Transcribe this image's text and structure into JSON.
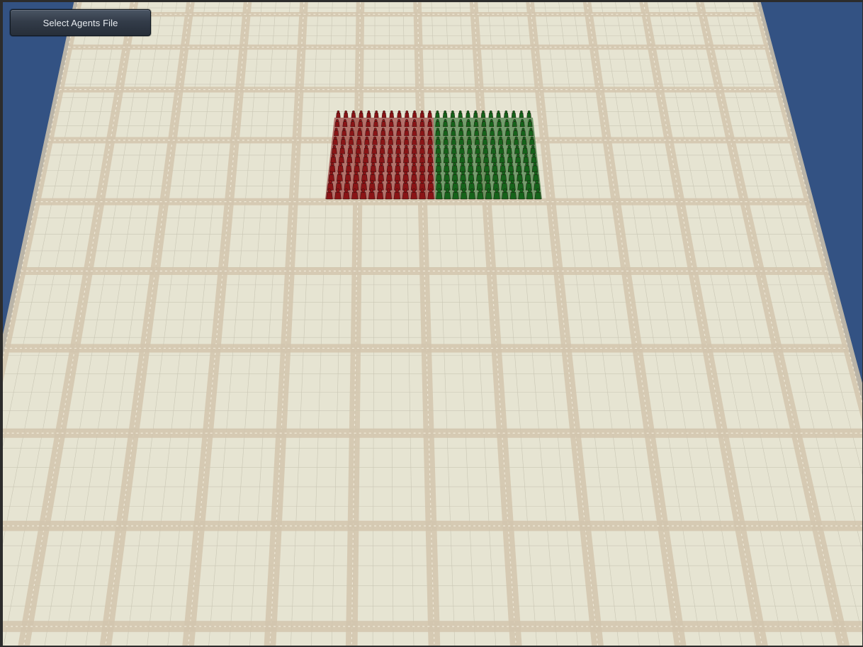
{
  "ui": {
    "select_agents_file_label": "Select Agents File"
  },
  "scene": {
    "sky_color": "#335283",
    "floor_base_color": "#e6e4d2",
    "floor_band_color": "#d2c6ae",
    "floor_grid_line_color": "#c9c6b4",
    "agent_groups": [
      {
        "name": "red",
        "color": "#8a1416",
        "columns": 13,
        "rows": 10
      },
      {
        "name": "green",
        "color": "#15631a",
        "columns": 13,
        "rows": 10
      }
    ]
  }
}
